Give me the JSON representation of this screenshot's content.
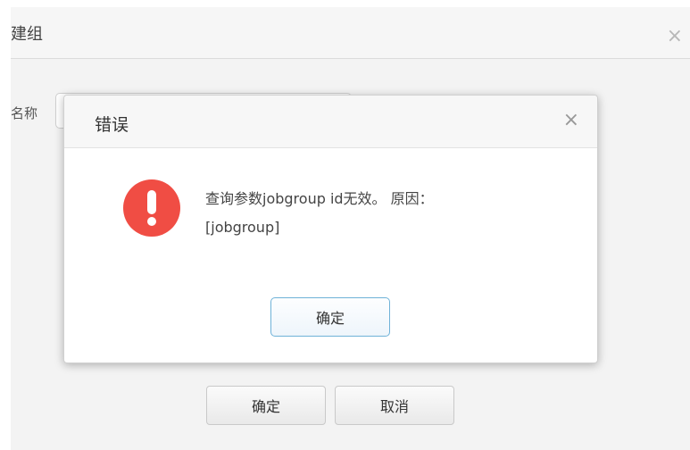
{
  "background_dialog": {
    "title": "建组",
    "close_glyph": "×",
    "name_label": "名称",
    "name_value": "",
    "buttons": {
      "ok": "确定",
      "cancel": "取消"
    }
  },
  "error_dialog": {
    "title": "错误",
    "close_glyph": "×",
    "icon": "error-exclamation-icon",
    "message_line1": "查询参数jobgroup id无效。 原因：",
    "message_line2": "[jobgroup]",
    "ok_button": "确定"
  },
  "colors": {
    "error_icon": "#f04d44",
    "primary_button_border": "#6fb2d8"
  }
}
